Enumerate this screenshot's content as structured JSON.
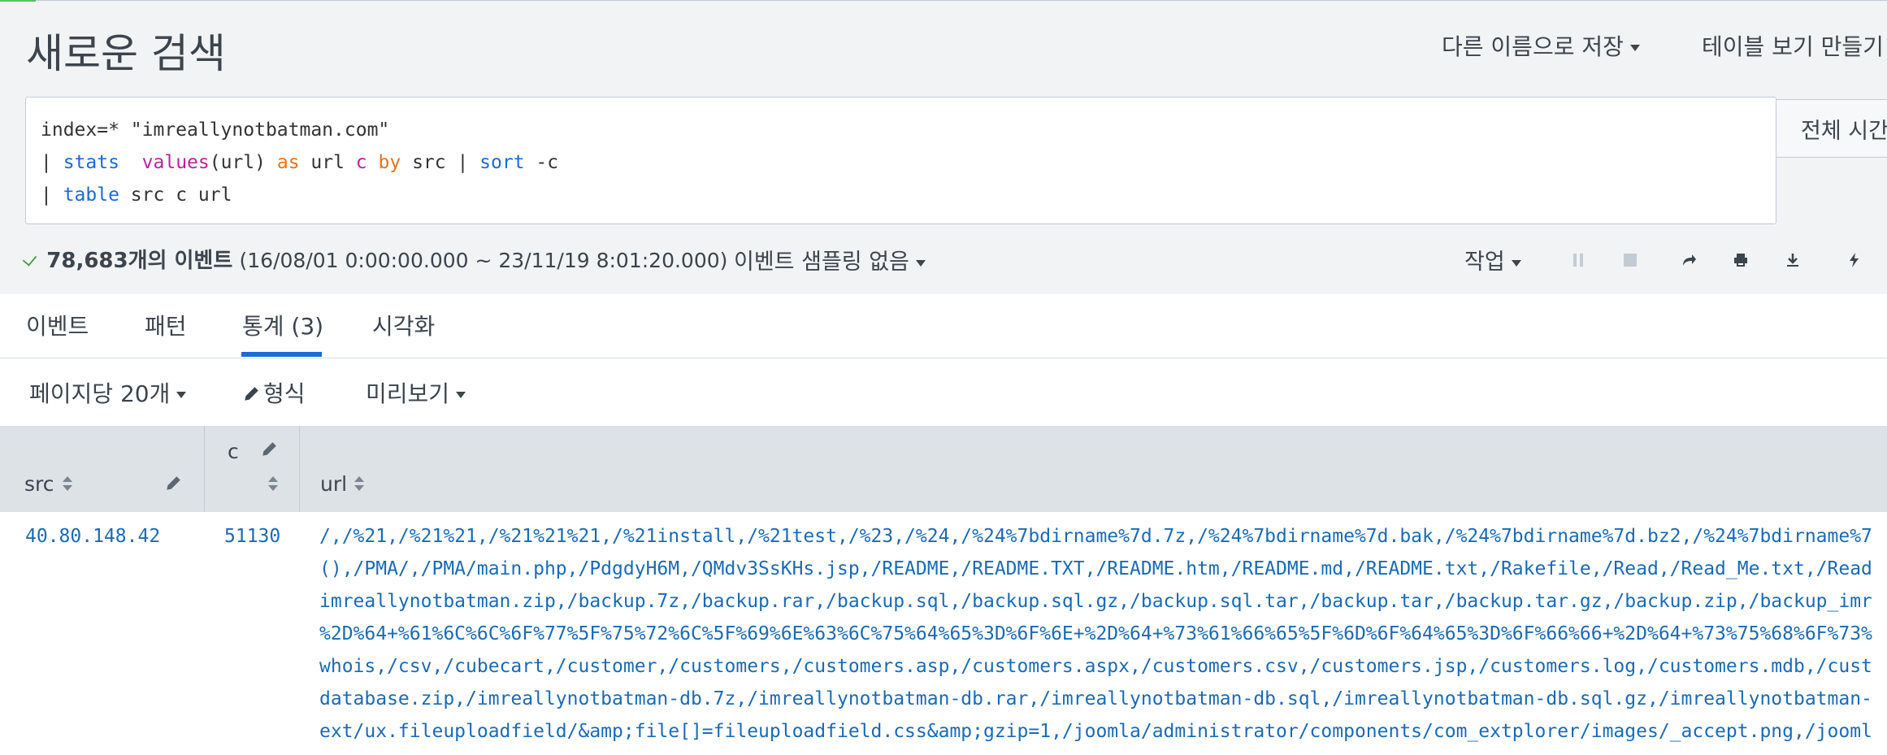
{
  "header": {
    "title": "새로운 검색",
    "save_as_label": "다른 이름으로 저장",
    "create_table_label": "테이블 보기 만들기"
  },
  "search": {
    "line1": "index=* \"imreallynotbatman.com\"",
    "line2_pipe": "| ",
    "line2_stats": "stats",
    "line2_values": "values",
    "line2_url": "(url) ",
    "line2_as": "as",
    "line2_url2": " url ",
    "line2_c": "c",
    "line2_by": "by",
    "line2_src": " src | ",
    "line2_sort": "sort",
    "line2_c2": " -c",
    "line3_pipe": "| ",
    "line3_table": "table",
    "line3_rest": " src c url",
    "time_picker_label": "전체 시간"
  },
  "status": {
    "event_count": "78,683개의 이벤트",
    "range": "(16/08/01 0:00:00.000 ~ 23/11/19 8:01:20.000)",
    "sampling_label": "이벤트 샘플링 없음",
    "job_label": "작업"
  },
  "tabs": [
    {
      "label": "이벤트"
    },
    {
      "label": "패턴"
    },
    {
      "label": "통계 (3)"
    },
    {
      "label": "시각화"
    }
  ],
  "controls": {
    "per_page": "페이지당 20개",
    "format": "형식",
    "preview": "미리보기"
  },
  "table": {
    "columns": [
      "src",
      "c",
      "url"
    ],
    "rows": [
      {
        "src": "40.80.148.42",
        "c": "51130",
        "url_lines": [
          "/,/%21,/%21%21,/%21%21%21,/%21install,/%21test,/%23,/%24,/%24%7bdirname%7d.7z,/%24%7bdirname%7d.bak,/%24%7bdirname%7d.bz2,/%24%7bdirname%7",
          "(),/PMA/,/PMA/main.php,/PdgdyH6M,/QMdv3SsKHs.jsp,/README,/README.TXT,/README.htm,/README.md,/README.txt,/Rakefile,/Read,/Read_Me.txt,/Read",
          "imreallynotbatman.zip,/backup.7z,/backup.rar,/backup.sql,/backup.sql.gz,/backup.sql.tar,/backup.tar,/backup.tar.gz,/backup.zip,/backup_imr",
          "%2D%64+%61%6C%6C%6F%77%5F%75%72%6C%5F%69%6E%63%6C%75%64%65%3D%6F%6E+%2D%64+%73%61%66%65%5F%6D%6F%64%65%3D%6F%66%66+%2D%64+%73%75%68%6F%73%",
          "whois,/csv,/cubecart,/customer,/customers,/customers.asp,/customers.aspx,/customers.csv,/customers.jsp,/customers.log,/customers.mdb,/cust",
          "database.zip,/imreallynotbatman-db.7z,/imreallynotbatman-db.rar,/imreallynotbatman-db.sql,/imreallynotbatman-db.sql.gz,/imreallynotbatman-",
          "ext/ux.fileuploadfield/&amp;file[]=fileuploadfield.css&amp;gzip=1,/joomla/administrator/components/com_extplorer/images/_accept.png,/jooml"
        ]
      }
    ]
  },
  "colors": {
    "accent": "#1a6bd6",
    "link": "#1a6bb6",
    "header_bg": "#f2f3f5",
    "table_header_bg": "#dde2e7"
  }
}
